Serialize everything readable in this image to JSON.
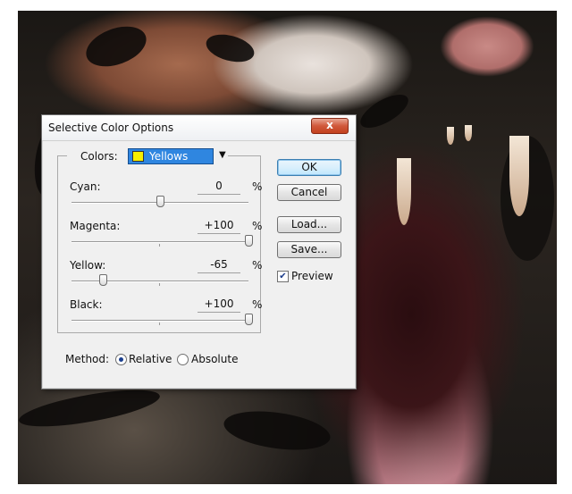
{
  "dialog": {
    "title": "Selective Color Options",
    "close_label": "x"
  },
  "colors": {
    "label": "Colors:",
    "selected": "Yellows",
    "swatch_color": "#f7ef00"
  },
  "sliders": [
    {
      "label": "Cyan:",
      "value": "0",
      "unit": "%",
      "percent": 0
    },
    {
      "label": "Magenta:",
      "value": "+100",
      "unit": "%",
      "percent": 100
    },
    {
      "label": "Yellow:",
      "value": "-65",
      "unit": "%",
      "percent": -65
    },
    {
      "label": "Black:",
      "value": "+100",
      "unit": "%",
      "percent": 100
    }
  ],
  "buttons": {
    "ok": "OK",
    "cancel": "Cancel",
    "load": "Load...",
    "save": "Save..."
  },
  "preview": {
    "label": "Preview",
    "checked": true
  },
  "method": {
    "label": "Method:",
    "options": [
      {
        "label": "Relative",
        "selected": true
      },
      {
        "label": "Absolute",
        "selected": false
      }
    ]
  }
}
